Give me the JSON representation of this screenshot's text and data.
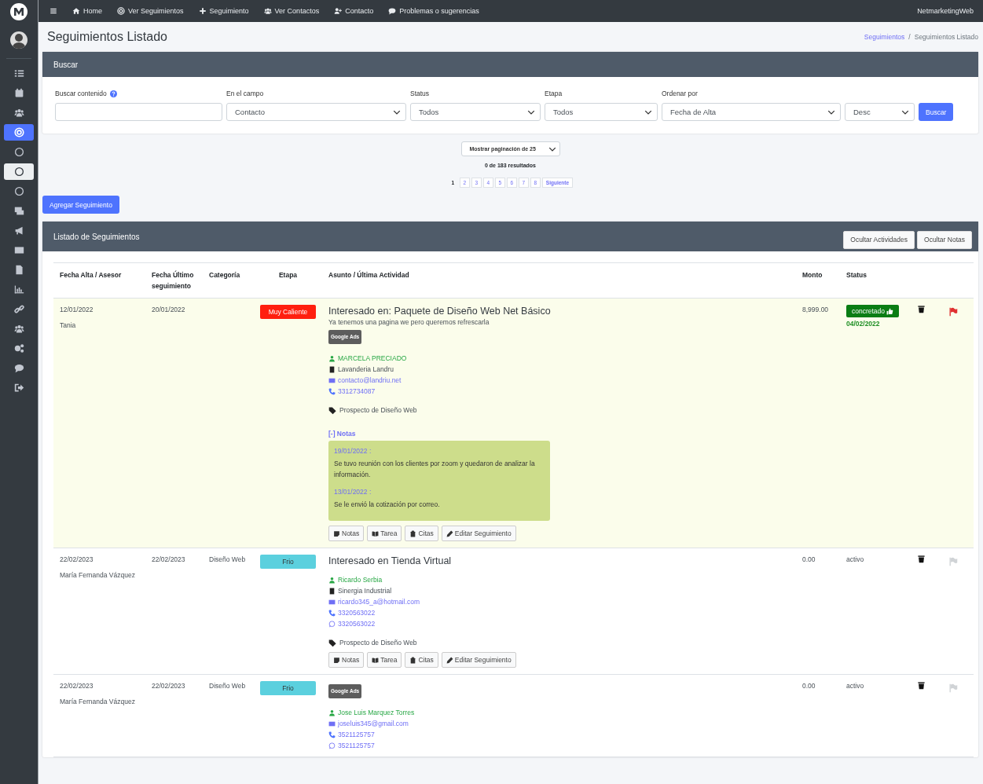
{
  "topbar": {
    "nav": [
      {
        "kind": "menu"
      },
      {
        "kind": "home",
        "label": "Home"
      },
      {
        "kind": "target",
        "label": "Ver Seguimientos"
      },
      {
        "kind": "plus",
        "label": "Seguimiento"
      },
      {
        "kind": "users",
        "label": "Ver Contactos"
      },
      {
        "kind": "user-plus",
        "label": "Contacto"
      },
      {
        "kind": "chat",
        "label": "Problemas o sugerencias"
      }
    ],
    "brand": "NetmarketingWeb"
  },
  "sidebar": {
    "items": [
      {
        "kind": "list",
        "selected": false,
        "hovered": false
      },
      {
        "kind": "calendar",
        "selected": false,
        "hovered": false
      },
      {
        "kind": "users",
        "selected": false,
        "hovered": false
      },
      {
        "kind": "target",
        "selected": true,
        "hovered": false
      },
      {
        "kind": "circle",
        "selected": false,
        "hovered": false
      },
      {
        "kind": "circle",
        "selected": false,
        "hovered": true
      },
      {
        "kind": "circle",
        "selected": false,
        "hovered": false
      },
      {
        "kind": "mail-stack",
        "selected": false,
        "hovered": false
      },
      {
        "kind": "megaphone",
        "selected": false,
        "hovered": false
      },
      {
        "kind": "envelope",
        "selected": false,
        "hovered": false
      },
      {
        "kind": "document",
        "selected": false,
        "hovered": false
      },
      {
        "kind": "chart",
        "selected": false,
        "hovered": false
      },
      {
        "kind": "link",
        "selected": false,
        "hovered": false
      },
      {
        "kind": "users",
        "selected": false,
        "hovered": false
      },
      {
        "kind": "gears",
        "selected": false,
        "hovered": false
      },
      {
        "kind": "chat",
        "selected": false,
        "hovered": false
      },
      {
        "kind": "logout",
        "selected": false,
        "hovered": false
      }
    ]
  },
  "page_title": "Seguimientos Listado",
  "breadcrumb": {
    "separator": "/",
    "items": [
      {
        "label": "Seguimientos",
        "link": true
      },
      {
        "label": "Seguimientos Listado",
        "link": false
      }
    ]
  },
  "search": {
    "title": "Buscar",
    "fields": [
      {
        "kind": "text",
        "label": "Buscar contenido",
        "help": true
      },
      {
        "kind": "select",
        "label": "En el campo",
        "value": "Contacto"
      },
      {
        "kind": "select",
        "label": "Status",
        "value": "Todos"
      },
      {
        "kind": "select",
        "label": "Etapa",
        "value": "Todos"
      },
      {
        "kind": "select",
        "label": "Ordenar por",
        "value": "Fecha de Alta"
      },
      {
        "kind": "select",
        "value": "Desc"
      }
    ],
    "button": "Buscar"
  },
  "pagination": {
    "page_size": "Mostrar paginación de 25",
    "summary": "0 de 183 resultados",
    "pages": [
      {
        "label": "1",
        "selected": true
      },
      {
        "label": "2",
        "selected": false
      },
      {
        "label": "3",
        "selected": false
      },
      {
        "label": "4",
        "selected": false
      },
      {
        "label": "5",
        "selected": false
      },
      {
        "label": "6",
        "selected": false
      },
      {
        "label": "7",
        "selected": false
      },
      {
        "label": "8",
        "selected": false
      }
    ],
    "next": "Siguiente"
  },
  "add_button": "Agregar Seguimiento",
  "list": {
    "title": "Listado de Seguimientos",
    "buttons": [
      "Ocultar Actividades",
      "Ocultar Notas"
    ],
    "columns": [
      "Fecha Alta / Asesor",
      "Fecha Último seguimiento",
      "Categoría",
      "Etapa",
      "Asunto / Última Actividad",
      "Monto",
      "Status"
    ],
    "rows": [
      {
        "highlighted": true,
        "fecha_alta": "12/01/2022",
        "asesor": "Tania",
        "fecha_ultimo": "20/01/2022",
        "etapa": {
          "label": "Muy Caliente",
          "color": "#ff1f0f"
        },
        "asunto": "Interesado en: Paquete de Diseño Web Net Básico",
        "descripcion": "Ya tenemos una pagina we pero queremos refrescarla",
        "source": "Google Ads",
        "contact": {
          "name": "MARCELA PRECIADO",
          "company": "Lavanderia Landru",
          "email": "contacto@landriu.net",
          "phone": "3312734087"
        },
        "tag": "Prospecto de Diseño Web",
        "notes": {
          "toggle": "[-] Notas",
          "entries": [
            {
              "date": "19/01/2022 :",
              "text": "Se tuvo reunión con los clientes por zoom y quedaron de analizar la información."
            },
            {
              "date": "13/01/2022 :",
              "text": "Se le envió la cotización por correo."
            }
          ]
        },
        "actions": [
          {
            "kind": "note",
            "label": "Notas"
          },
          {
            "kind": "book",
            "label": "Tarea"
          },
          {
            "kind": "clipboard",
            "label": "Citas"
          },
          {
            "kind": "pencil",
            "label": "Editar Seguimiento"
          }
        ],
        "monto": "8,999.00",
        "status": {
          "kind": "concretado",
          "label": "concretado",
          "date": "04/02/2022"
        },
        "flagged": true
      },
      {
        "highlighted": false,
        "fecha_alta": "22/02/2023",
        "asesor": "María Fernanda Vázquez",
        "fecha_ultimo": "22/02/2023",
        "categoria": "Diseño Web",
        "etapa": {
          "label": "Frio",
          "color": "#5bd0de"
        },
        "asunto": "Interesado en Tienda Virtual",
        "contact": {
          "name": "Ricardo Serbia",
          "company": "Sinergia Industrial",
          "email": "ricardo345_a@hotmail.com",
          "phone": "3320563022",
          "whatsapp": "3320563022"
        },
        "tag": "Prospecto de Diseño Web",
        "actions": [
          {
            "kind": "note",
            "label": "Notas"
          },
          {
            "kind": "book",
            "label": "Tarea"
          },
          {
            "kind": "clipboard",
            "label": "Citas"
          },
          {
            "kind": "pencil",
            "label": "Editar Seguimiento"
          }
        ],
        "monto": "0.00",
        "status": {
          "kind": "activo",
          "label": "activo"
        },
        "flagged": false
      },
      {
        "highlighted": false,
        "fecha_alta": "22/02/2023",
        "asesor": "María Fernanda Vázquez",
        "fecha_ultimo": "22/02/2023",
        "categoria": "Diseño Web",
        "etapa": {
          "label": "Frio",
          "color": "#5bd0de"
        },
        "source": "Google Ads",
        "contact": {
          "name": "Jose Luis Marquez Torres",
          "email": "joseluis345@gmail.com",
          "phone": "3521125757",
          "whatsapp": "3521125757"
        },
        "monto": "0.00",
        "status": {
          "kind": "activo",
          "label": "activo"
        },
        "flagged": false
      }
    ]
  }
}
